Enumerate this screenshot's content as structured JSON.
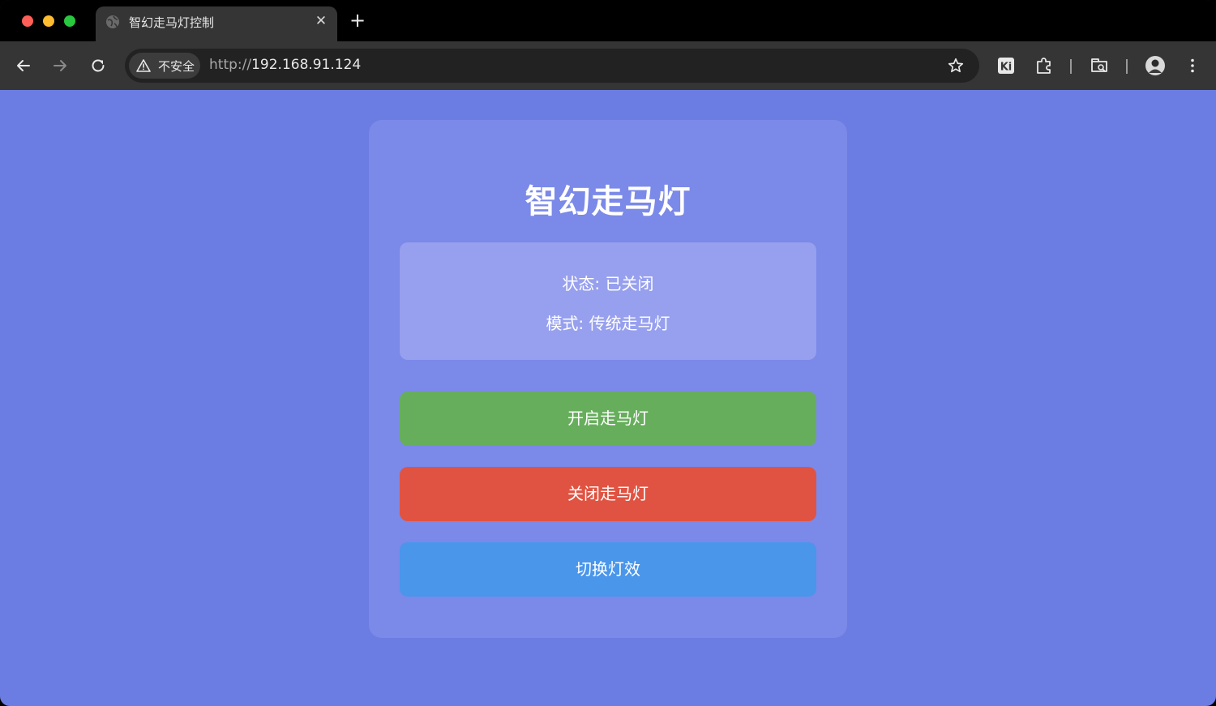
{
  "browser": {
    "tab": {
      "title": "智幻走马灯控制",
      "close_glyph": "✕"
    },
    "new_tab_glyph": "+",
    "omnibox": {
      "security_label": "不安全",
      "url_scheme": "http://",
      "url_host": "192.168.91.124"
    },
    "icons": {
      "back": "arrow-left-icon",
      "forward": "arrow-right-icon",
      "reload": "reload-icon",
      "bookmark": "star-icon",
      "extension_ki": "ki-extension-icon",
      "extensions": "puzzle-icon",
      "search_tabs": "tab-search-icon",
      "profile": "profile-avatar",
      "menu": "more-vert-icon"
    },
    "ki_label": "Ki"
  },
  "page": {
    "background": "#6b7de2",
    "title": "智幻走马灯",
    "status": {
      "state_line": "状态: 已关闭",
      "mode_line": "模式: 传统走马灯"
    },
    "buttons": {
      "on": {
        "label": "开启走马灯",
        "color": "#67ae5c"
      },
      "off": {
        "label": "关闭走马灯",
        "color": "#e05342"
      },
      "toggle": {
        "label": "切换灯效",
        "color": "#4996eb"
      }
    }
  }
}
